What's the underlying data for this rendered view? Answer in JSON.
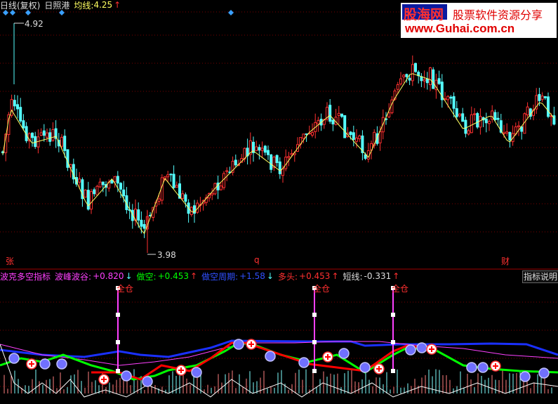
{
  "title_bar": {
    "period": "日线(复权)",
    "stock_name": "日照港",
    "ma_label": "均线:",
    "ma_value": "4.25",
    "ma_arrow": "↑"
  },
  "watermark": {
    "brand": "股海网",
    "slogan": "股票软件资源分享",
    "url": "www.Guhai.com.cn"
  },
  "price_chart": {
    "high_label": "4.92",
    "low_label": "3.98",
    "markers": [
      "张",
      "q",
      "财"
    ]
  },
  "indicator_bar": {
    "name": "波克多空指标",
    "wave_label": "波峰波谷:",
    "wave_value": "+0.820",
    "wave_arrow": "↓",
    "short_label": "做空:",
    "short_value": "+0.453",
    "short_arrow": "↑",
    "cycle_label": "做空周期:",
    "cycle_value": "+1.58",
    "cycle_arrow": "↓",
    "long_label": "多头:",
    "long_value": "+0.453",
    "long_arrow": "↑",
    "st_label": "短线:",
    "st_value": "-0.331",
    "st_arrow": "↑",
    "help_button": "指标说明"
  },
  "signals": [
    "全仓",
    "全仓",
    "全仓"
  ],
  "colors": {
    "up_candle": "#ff3030",
    "down_candle": "#54ffff",
    "ma_line": "#ffff60",
    "blue_line": "#1a30ff",
    "magenta_line": "#ff40ff",
    "green_line": "#00ff00",
    "red_line": "#ff0000"
  }
}
